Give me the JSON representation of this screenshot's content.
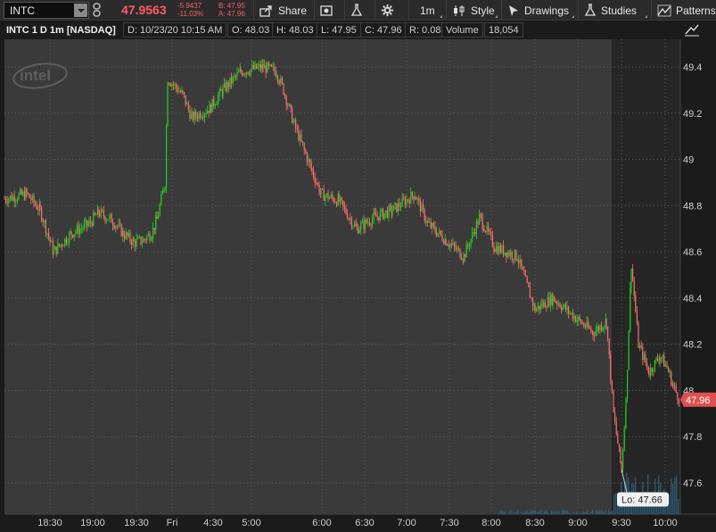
{
  "toolbar": {
    "symbol": "INTC",
    "last_price": "47.9563",
    "change_abs": "-5.9437",
    "change_pct": "-11.03%",
    "bid": "B: 47.95",
    "ask": "A: 47.96",
    "buttons": {
      "share": "Share",
      "aggregation": "1m",
      "style": "Style",
      "drawings": "Drawings",
      "studies": "Studies",
      "patterns": "Patterns"
    }
  },
  "header": {
    "title": "INTC 1 D 1m [NASDAQ]",
    "date": "D: 10/23/20 10:15 AM",
    "open": "O: 48.03",
    "high": "H: 48.03",
    "low": "L: 47.95",
    "close": "C: 47.96",
    "range": "R: 0.08",
    "volume_label": "Volume",
    "volume_value": "18,054"
  },
  "colors": {
    "up": "#1fd31f",
    "down": "#ff6d6d",
    "price_tag": "#e05050",
    "grid": "#555555"
  },
  "chart_data": {
    "type": "candlestick",
    "symbol": "INTC",
    "title": "INTC 1 D 1m [NASDAQ]",
    "x_ticks": [
      "18:30",
      "19:00",
      "19:30",
      "Fri",
      "4:30",
      "5:00",
      "6:00",
      "6:30",
      "7:00",
      "7:30",
      "8:00",
      "8:30",
      "9:00",
      "9:30",
      "10:00"
    ],
    "y_ticks": [
      "47.6",
      "47.8",
      "48",
      "48.2",
      "48.4",
      "48.6",
      "48.8",
      "49",
      "49.2",
      "49.4"
    ],
    "ylim": [
      47.45,
      49.5
    ],
    "grid": true,
    "current_price_label": "47.96",
    "low_annotation": "Lo: 47.66",
    "watermark": "intel",
    "price_path": [
      [
        "18:00",
        48.83
      ],
      [
        "18:10",
        48.85
      ],
      [
        "18:20",
        48.78
      ],
      [
        "18:25",
        48.6
      ],
      [
        "18:35",
        48.68
      ],
      [
        "18:50",
        48.72
      ],
      [
        "19:00",
        48.77
      ],
      [
        "19:15",
        48.74
      ],
      [
        "19:25",
        48.68
      ],
      [
        "19:35",
        48.64
      ],
      [
        "19:45",
        48.65
      ],
      [
        "19:55",
        48.68
      ],
      [
        "20:00",
        48.74
      ],
      [
        "Fri 04:00",
        48.9
      ],
      [
        "Fri 04:01",
        49.35
      ],
      [
        "Fri 04:10",
        49.28
      ],
      [
        "Fri 04:20",
        49.18
      ],
      [
        "Fri 04:35",
        49.22
      ],
      [
        "Fri 04:45",
        49.3
      ],
      [
        "Fri 05:00",
        49.38
      ],
      [
        "Fri 05:20",
        49.4
      ],
      [
        "Fri 05:35",
        49.38
      ],
      [
        "Fri 05:45",
        49.3
      ],
      [
        "Fri 05:55",
        49.15
      ],
      [
        "Fri 06:00",
        48.95
      ],
      [
        "Fri 06:05",
        48.85
      ],
      [
        "Fri 06:20",
        48.82
      ],
      [
        "Fri 06:35",
        48.7
      ],
      [
        "Fri 06:50",
        48.75
      ],
      [
        "Fri 07:00",
        48.78
      ],
      [
        "Fri 07:10",
        48.85
      ],
      [
        "Fri 07:20",
        48.72
      ],
      [
        "Fri 07:40",
        48.65
      ],
      [
        "Fri 07:55",
        48.58
      ],
      [
        "Fri 08:05",
        48.75
      ],
      [
        "Fri 08:15",
        48.62
      ],
      [
        "Fri 08:30",
        48.58
      ],
      [
        "Fri 08:40",
        48.35
      ],
      [
        "Fri 08:50",
        48.4
      ],
      [
        "Fri 09:00",
        48.3
      ],
      [
        "Fri 09:10",
        48.25
      ],
      [
        "Fri 09:20",
        48.3
      ],
      [
        "Fri 09:26",
        47.9
      ],
      [
        "Fri 09:31",
        47.66
      ],
      [
        "Fri 09:36",
        47.95
      ],
      [
        "Fri 09:41",
        48.55
      ],
      [
        "Fri 09:47",
        48.2
      ],
      [
        "Fri 09:55",
        48.08
      ],
      [
        "Fri 10:02",
        48.15
      ],
      [
        "Fri 10:08",
        48.1
      ],
      [
        "Fri 10:12",
        48.02
      ],
      [
        "Fri 10:15",
        47.96
      ]
    ]
  }
}
